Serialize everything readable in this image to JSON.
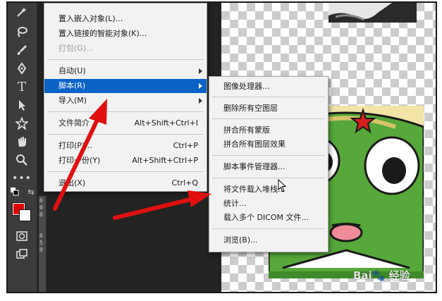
{
  "file_menu": {
    "items": [
      {
        "label": "置入嵌入对象(L)...",
        "shortcut": "",
        "submenu": false,
        "disabled": false
      },
      {
        "label": "置入链接的智能对象(K)...",
        "shortcut": "",
        "submenu": false,
        "disabled": false
      },
      {
        "label": "打包(G)...",
        "shortcut": "",
        "submenu": false,
        "disabled": true
      },
      {
        "label": "自动(U)",
        "shortcut": "",
        "submenu": true,
        "disabled": false
      },
      {
        "label": "脚本(R)",
        "shortcut": "",
        "submenu": true,
        "disabled": false,
        "highlighted": true
      },
      {
        "label": "导入(M)",
        "shortcut": "",
        "submenu": true,
        "disabled": false
      },
      {
        "label": "文件简介",
        "shortcut": "Alt+Shift+Ctrl+I",
        "submenu": false,
        "disabled": false
      },
      {
        "label": "打印(P)...",
        "shortcut": "Ctrl+P",
        "submenu": false,
        "disabled": false
      },
      {
        "label": "打印一份(Y)",
        "shortcut": "Alt+Shift+Ctrl+P",
        "submenu": false,
        "disabled": false
      },
      {
        "label": "退出(X)",
        "shortcut": "Ctrl+Q",
        "submenu": false,
        "disabled": false
      }
    ]
  },
  "script_menu": {
    "items": [
      {
        "label": "图像处理器..."
      },
      {
        "label": "删除所有空图层"
      },
      {
        "label": "拼合所有蒙版"
      },
      {
        "label": "拼合所有图层效果"
      },
      {
        "label": "脚本事件管理器..."
      },
      {
        "label": "将文件载入堆栈..."
      },
      {
        "label": "统计..."
      },
      {
        "label": "载入多个 DICOM 文件..."
      },
      {
        "label": "浏览(B)..."
      }
    ]
  },
  "toolbar": {
    "tools": [
      "magic-wand-icon",
      "lasso-icon",
      "brush-icon",
      "pen-icon",
      "type-icon",
      "path-select-icon",
      "custom-shape-icon",
      "hand-icon",
      "zoom-icon",
      "more-icon"
    ],
    "foreground_color": "#e00000",
    "background_color": "#ffffff"
  },
  "ruler": {
    "numbers": [
      "6",
      "0",
      "0",
      "6",
      "5",
      "0"
    ]
  },
  "watermark": "Bai🐾 经验",
  "colors": {
    "menu_highlight": "#0b63c7",
    "arrow": "#e01010"
  }
}
